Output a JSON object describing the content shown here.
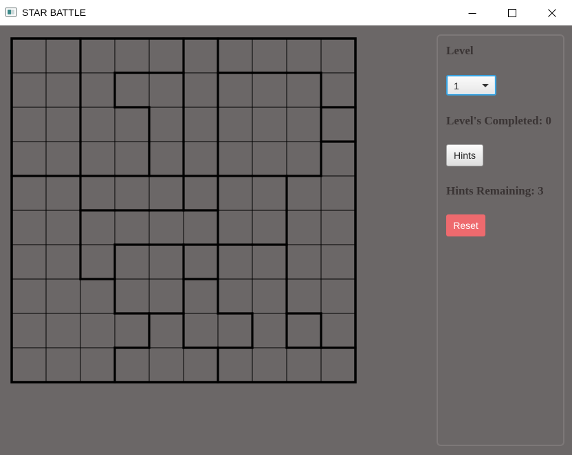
{
  "window": {
    "title": "STAR BATTLE",
    "icons": {
      "app": "app-icon",
      "minimize": "minimize-icon",
      "maximize": "maximize-icon",
      "close": "close-icon"
    }
  },
  "board": {
    "rows": 10,
    "cols": 10,
    "regions": [
      "aabbbcdddd",
      "aabeecfffd",
      "aabbecfffg",
      "aabbecfffd",
      "hhiiidjjdd",
      "hhkkkkjjdd",
      "hhklljkkdd",
      "hhhllhkkdd",
      "hhhhmhhkmd",
      "hhhmmmkkkk"
    ]
  },
  "sidebar": {
    "level_label": "Level",
    "level_value": "1",
    "levels_completed": "Level's Completed: 0",
    "hints_button": "Hints",
    "hints_remaining": "Hints Remaining: 3",
    "reset_button": "Reset"
  },
  "colors": {
    "background": "#6b6767",
    "grid_line": "#000000",
    "reset_button": "#ee6a6e",
    "focus_ring": "#3aa3e0"
  }
}
